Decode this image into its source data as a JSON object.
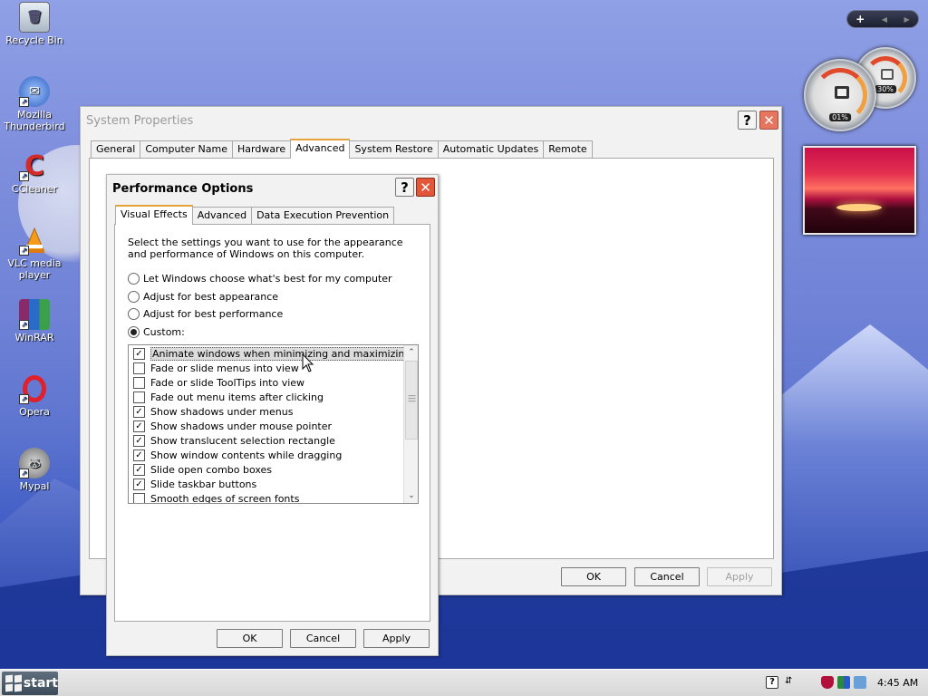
{
  "desktop": {
    "icons": [
      {
        "label": "Recycle Bin",
        "icon": "recycle-bin-icon"
      },
      {
        "label": "Mozilla Thunderbird",
        "icon": "thunderbird-icon"
      },
      {
        "label": "CCleaner",
        "icon": "ccleaner-icon"
      },
      {
        "label": "VLC media player",
        "icon": "vlc-icon"
      },
      {
        "label": "WinRAR",
        "icon": "winrar-icon"
      },
      {
        "label": "Opera",
        "icon": "opera-icon"
      },
      {
        "label": "Mypal",
        "icon": "mypal-icon"
      }
    ]
  },
  "gadgets": {
    "bar_buttons": [
      "+",
      "◀",
      "▶"
    ],
    "cpu_meter_value": "01%",
    "ram_meter_value": "30%"
  },
  "system_properties": {
    "title": "System Properties",
    "tabs": [
      "General",
      "Computer Name",
      "Hardware",
      "Advanced",
      "System Restore",
      "Automatic Updates",
      "Remote"
    ],
    "active_tab": "Advanced",
    "buttons": {
      "ok": "OK",
      "cancel": "Cancel",
      "apply": "Apply"
    }
  },
  "performance_options": {
    "title": "Performance Options",
    "tabs": [
      "Visual Effects",
      "Advanced",
      "Data Execution Prevention"
    ],
    "active_tab": "Visual Effects",
    "intro": "Select the settings you want to use for the appearance and performance of Windows on this computer.",
    "radio_options": [
      {
        "label": "Let Windows choose what's best for my computer",
        "selected": false
      },
      {
        "label": "Adjust for best appearance",
        "selected": false
      },
      {
        "label": "Adjust for best performance",
        "selected": false
      },
      {
        "label": "Custom:",
        "selected": true
      }
    ],
    "effects": [
      {
        "label": "Animate windows when minimizing and maximizing",
        "checked": true,
        "selected": true
      },
      {
        "label": "Fade or slide menus into view",
        "checked": false
      },
      {
        "label": "Fade or slide ToolTips into view",
        "checked": false
      },
      {
        "label": "Fade out menu items after clicking",
        "checked": false
      },
      {
        "label": "Show shadows under menus",
        "checked": true
      },
      {
        "label": "Show shadows under mouse pointer",
        "checked": true
      },
      {
        "label": "Show translucent selection rectangle",
        "checked": true
      },
      {
        "label": "Show window contents while dragging",
        "checked": true
      },
      {
        "label": "Slide open combo boxes",
        "checked": true
      },
      {
        "label": "Slide taskbar buttons",
        "checked": true
      },
      {
        "label": "Smooth edges of screen fonts",
        "checked": false
      }
    ],
    "buttons": {
      "ok": "OK",
      "cancel": "Cancel",
      "apply": "Apply"
    }
  },
  "taskbar": {
    "start_label": "start",
    "clock": "4:45 AM"
  }
}
